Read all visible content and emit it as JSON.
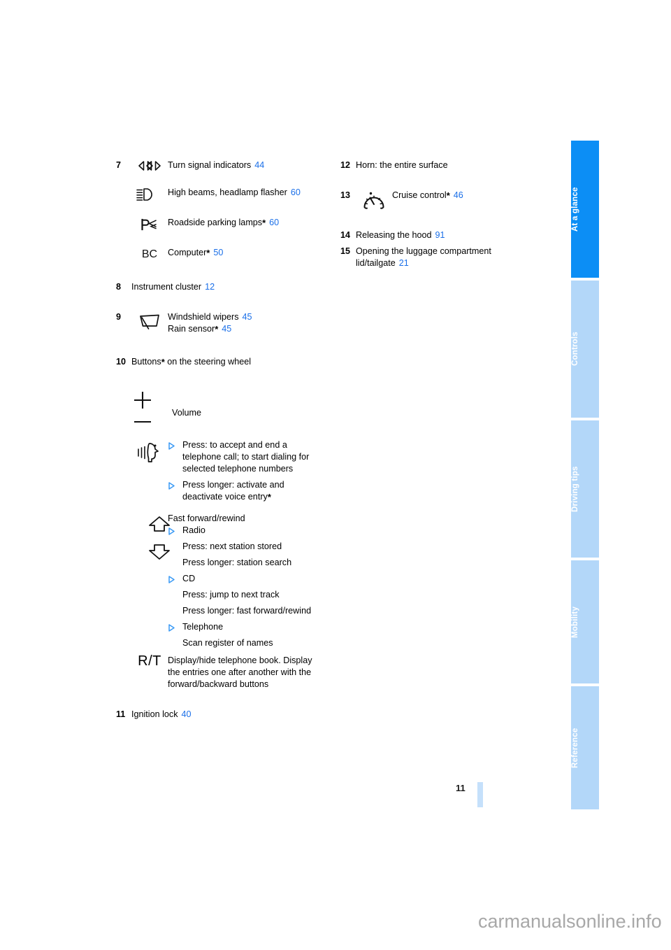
{
  "document": {
    "page_number": "11",
    "watermark": "carmanualsonline.info"
  },
  "tabs": [
    {
      "label": "At a glance",
      "active": true
    },
    {
      "label": "Controls",
      "active": false
    },
    {
      "label": "Driving tips",
      "active": false
    },
    {
      "label": "Mobility",
      "active": false
    },
    {
      "label": "Reference",
      "active": false
    }
  ],
  "left_column": {
    "item7": {
      "number": "7",
      "rows": [
        {
          "icon": "turn-signal-indicators-icon",
          "label": "Turn signal indicators",
          "page": "44",
          "asterisk": false
        },
        {
          "icon": "high-beams-headlamp-flasher-icon",
          "label": "High beams, headlamp flasher",
          "page": "60",
          "asterisk": false
        },
        {
          "icon": "roadside-parking-lamps-icon",
          "label": "Roadside parking lamps",
          "page": "60",
          "asterisk": true
        },
        {
          "icon": "onboard-computer-icon",
          "label": "Computer",
          "page": "50",
          "asterisk": true
        }
      ]
    },
    "item8": {
      "number": "8",
      "label": "Instrument cluster",
      "page": "12"
    },
    "item9": {
      "number": "9",
      "icon": "windshield-wiper-icon",
      "line1_label": "Windshield wipers",
      "line1_page": "45",
      "line2_label": "Rain sensor",
      "line2_asterisk": true,
      "line2_page": "45"
    },
    "item10": {
      "number": "10",
      "label_before": "Buttons",
      "asterisk": true,
      "label_after": " on the steering wheel",
      "volume": {
        "icon_plus": "plus-icon",
        "icon_minus": "minus-icon",
        "label": "Volume"
      },
      "telephone": {
        "icon": "voice-telephone-icon",
        "bullets": [
          "Press: to accept and end a telephone call; to start dialing for selected telephone numbers",
          "Press longer: activate and deactivate voice entry"
        ],
        "bullet2_asterisk": true
      },
      "fast_forward": {
        "icon_up": "arrow-up-icon",
        "icon_down": "arrow-down-icon",
        "heading": "Fast forward/rewind",
        "groups": [
          {
            "bullet": "Radio",
            "lines": [
              "Press: next station stored",
              "Press longer: station search"
            ]
          },
          {
            "bullet": "CD",
            "lines": [
              "Press: jump to next track",
              "Press longer: fast forward/rewind"
            ]
          },
          {
            "bullet": "Telephone",
            "lines": [
              "Scan register of names"
            ]
          }
        ]
      },
      "rt": {
        "glyph": "R/T",
        "text": "Display/hide telephone book. Display the entries one after another with the forward/backward buttons"
      }
    },
    "item11": {
      "number": "11",
      "label": "Ignition lock",
      "page": "40"
    }
  },
  "right_column": {
    "item12": {
      "number": "12",
      "label": "Horn: the entire surface"
    },
    "item13": {
      "number": "13",
      "icon": "cruise-control-icon",
      "label": "Cruise control",
      "asterisk": true,
      "page": "46"
    },
    "item14": {
      "number": "14",
      "label": "Releasing the hood",
      "page": "91"
    },
    "item15": {
      "number": "15",
      "label": "Opening the luggage compartment lid/tailgate",
      "page": "21"
    }
  },
  "colors": {
    "link_blue": "#1a6fe8",
    "tab_active": "#0c8ef5",
    "tab_inactive": "#b3d7f9",
    "page_bar": "#c5e0fb",
    "watermark_gray": "#a8a8a8"
  }
}
